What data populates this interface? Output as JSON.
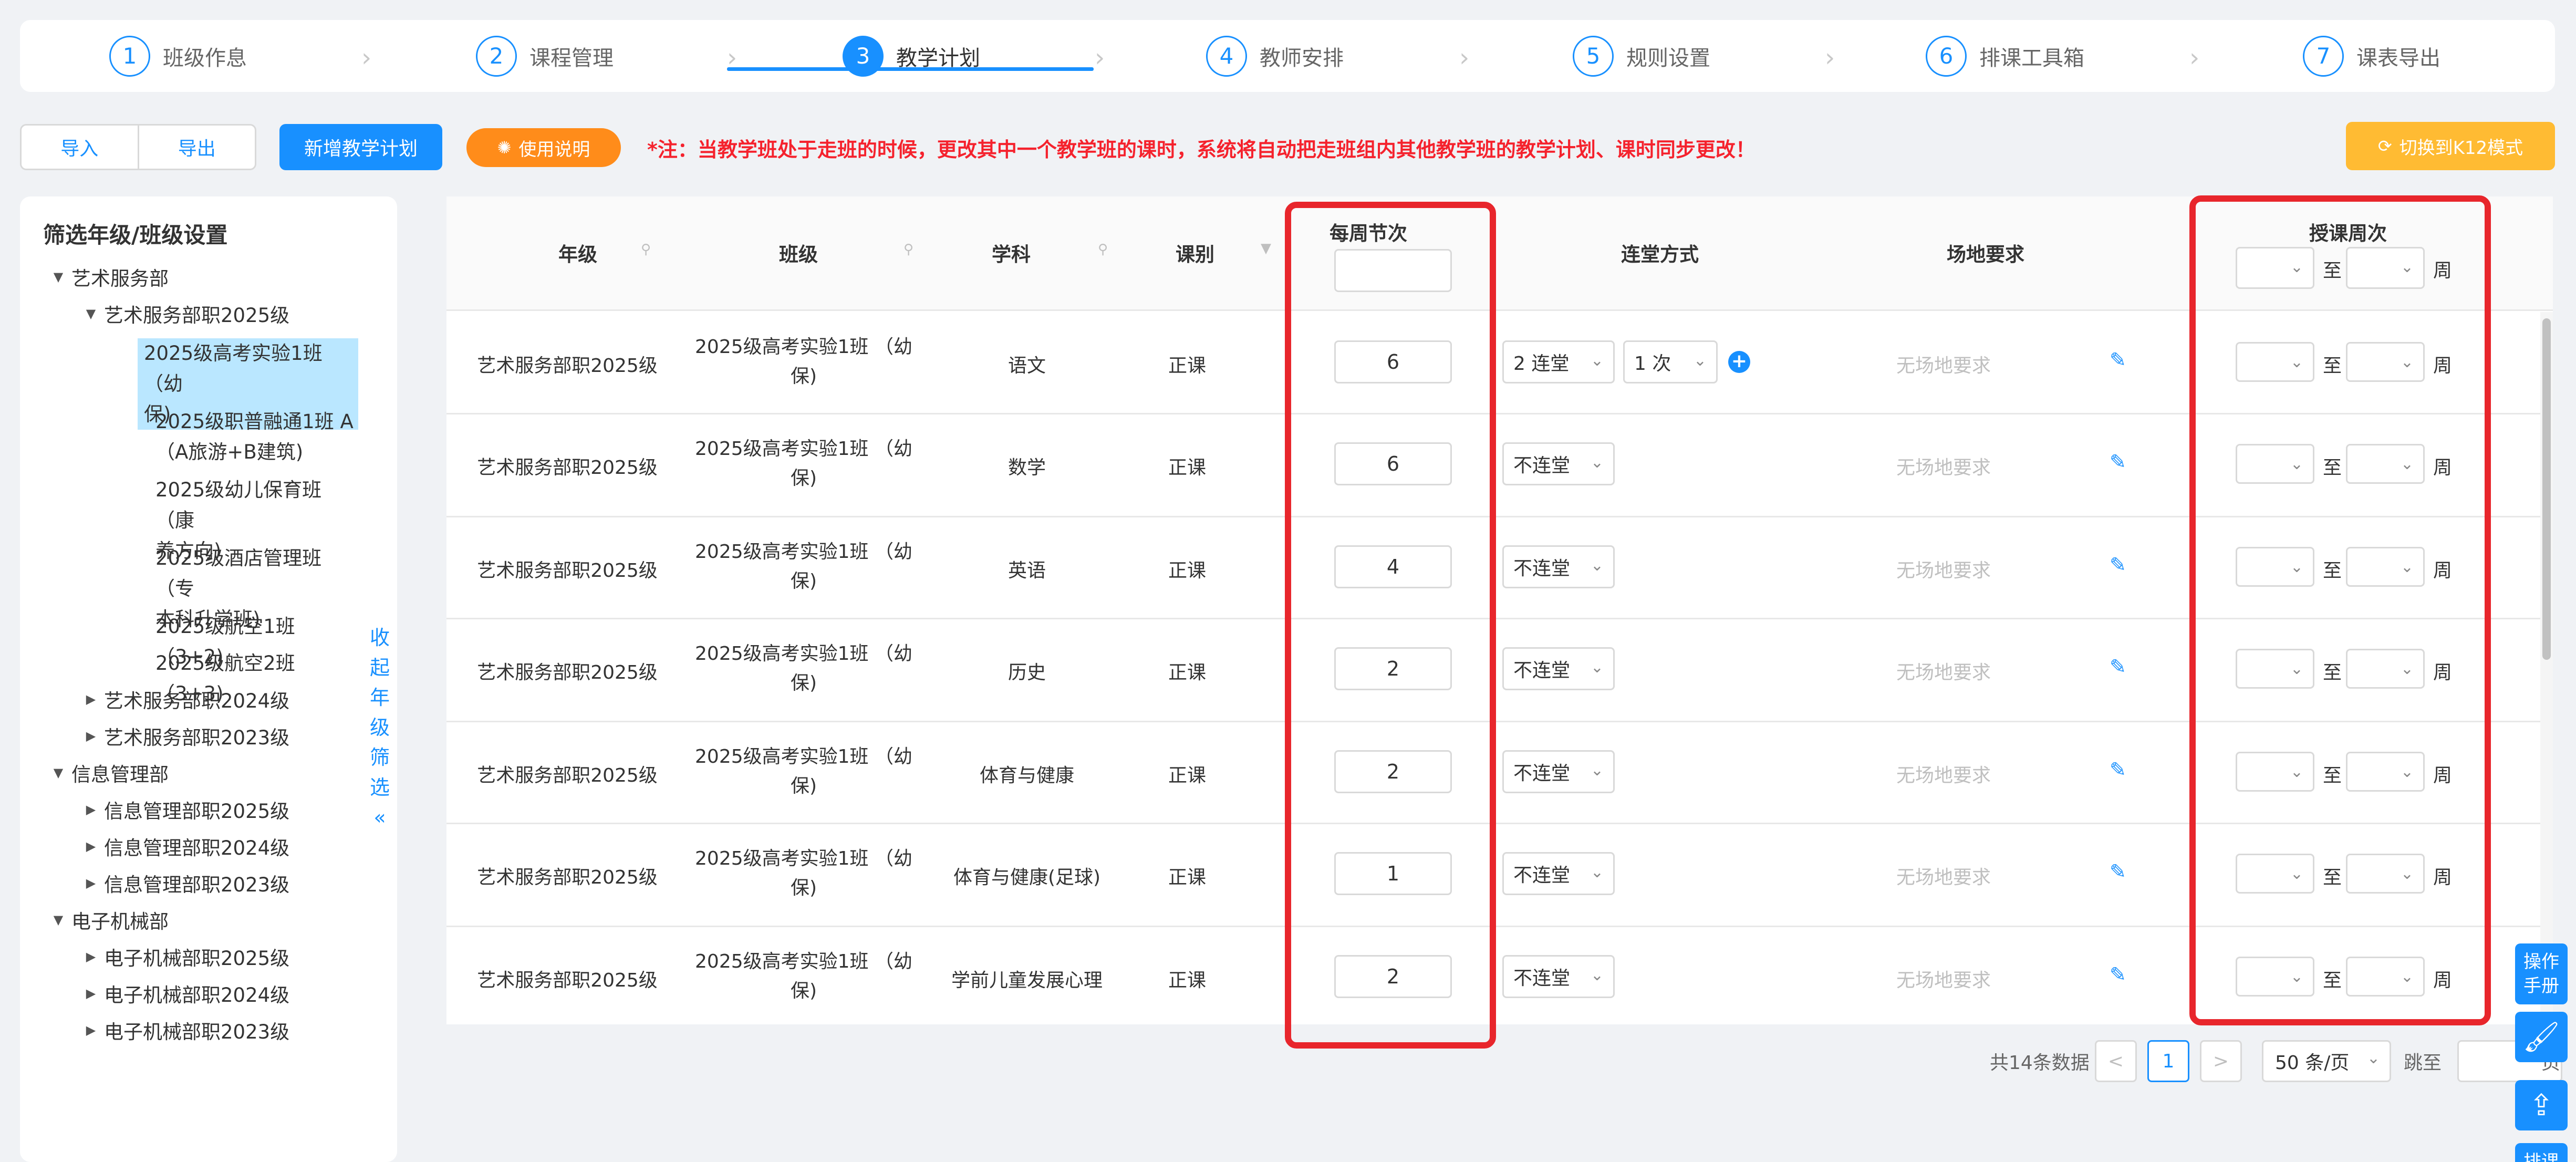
{
  "steps": [
    {
      "num": "1",
      "label": "班级作息"
    },
    {
      "num": "2",
      "label": "课程管理"
    },
    {
      "num": "3",
      "label": "教学计划",
      "active": true
    },
    {
      "num": "4",
      "label": "教师安排"
    },
    {
      "num": "5",
      "label": "规则设置"
    },
    {
      "num": "6",
      "label": "排课工具箱"
    },
    {
      "num": "7",
      "label": "课表导出"
    }
  ],
  "toolbar": {
    "import_label": "导入",
    "export_label": "导出",
    "add_plan_label": "新增教学计划",
    "usage_label": "使用说明",
    "notice": "*注：当教学班处于走班的时候，更改其中一个教学班的课时，系统将自动把走班组内其他教学班的教学计划、课时同步更改！",
    "k12_label": "切换到K12模式"
  },
  "sidebar": {
    "title": "筛选年级/班级设置",
    "dept1": "艺术服务部",
    "dept1_grade2025": "艺术服务部职2025级",
    "classes": [
      [
        "2025级高考实验1班 （幼",
        "保)"
      ],
      [
        "2025级职普融通1班 A",
        "（A旅游+B建筑)"
      ],
      [
        "2025级幼儿保育班 （康",
        "养方向)"
      ],
      [
        "2025级酒店管理班 （专",
        "本科升学班)"
      ],
      [
        "2025级航空1班 （3+2)"
      ],
      [
        "2025级航空2班 （3+3)"
      ]
    ],
    "dept1_grade2024": "艺术服务部职2024级",
    "dept1_grade2023": "艺术服务部职2023级",
    "dept2": "信息管理部",
    "dept2_grades": [
      "信息管理部职2025级",
      "信息管理部职2024级",
      "信息管理部职2023级"
    ],
    "dept3": "电子机械部",
    "dept3_grades": [
      "电子机械部职2025级",
      "电子机械部职2024级",
      "电子机械部职2023级"
    ],
    "collapse_chars": [
      "收",
      "起",
      "年",
      "级",
      "筛",
      "选",
      "«"
    ]
  },
  "table": {
    "headers": {
      "grade": "年级",
      "class": "班级",
      "subject": "学科",
      "type": "课别",
      "weekly": "每周节次",
      "consecutive": "连堂方式",
      "venue": "场地要求",
      "weeks": "授课周次",
      "to": "至",
      "week_unit": "周"
    },
    "rows": [
      {
        "grade": "艺术服务部职2025级",
        "class1": "2025级高考实验1班 （幼",
        "class2": "保)",
        "subject": "语文",
        "type": "正课",
        "weekly": "6",
        "consec": "2 连堂",
        "times": "1 次",
        "venue": "无场地要求"
      },
      {
        "grade": "艺术服务部职2025级",
        "class1": "2025级高考实验1班 （幼",
        "class2": "保)",
        "subject": "数学",
        "type": "正课",
        "weekly": "6",
        "consec": "不连堂",
        "venue": "无场地要求"
      },
      {
        "grade": "艺术服务部职2025级",
        "class1": "2025级高考实验1班 （幼",
        "class2": "保)",
        "subject": "英语",
        "type": "正课",
        "weekly": "4",
        "consec": "不连堂",
        "venue": "无场地要求"
      },
      {
        "grade": "艺术服务部职2025级",
        "class1": "2025级高考实验1班 （幼",
        "class2": "保)",
        "subject": "历史",
        "type": "正课",
        "weekly": "2",
        "consec": "不连堂",
        "venue": "无场地要求"
      },
      {
        "grade": "艺术服务部职2025级",
        "class1": "2025级高考实验1班 （幼",
        "class2": "保)",
        "subject": "体育与健康",
        "type": "正课",
        "weekly": "2",
        "consec": "不连堂",
        "venue": "无场地要求"
      },
      {
        "grade": "艺术服务部职2025级",
        "class1": "2025级高考实验1班 （幼",
        "class2": "保)",
        "subject": "体育与健康(足球)",
        "type": "正课",
        "weekly": "1",
        "consec": "不连堂",
        "venue": "无场地要求"
      },
      {
        "grade": "艺术服务部职2025级",
        "class1": "2025级高考实验1班 （幼",
        "class2": "保)",
        "subject": "学前儿童发展心理",
        "type": "正课",
        "weekly": "2",
        "consec": "不连堂",
        "venue": "无场地要求"
      }
    ]
  },
  "pagination": {
    "total": "共14条数据",
    "prev": "<",
    "page": "1",
    "next": ">",
    "page_size": "50 条/页",
    "jump": "跳至",
    "page_suffix": "页"
  },
  "float": {
    "manual": [
      "操作",
      "手册"
    ],
    "schedule": "排课"
  },
  "colors": {
    "primary": "#1890ff",
    "highlight": "#e8262c",
    "notice": "#f5222d",
    "usage_btn": "#ff8c1a",
    "k12_btn": "#ffbb33"
  }
}
